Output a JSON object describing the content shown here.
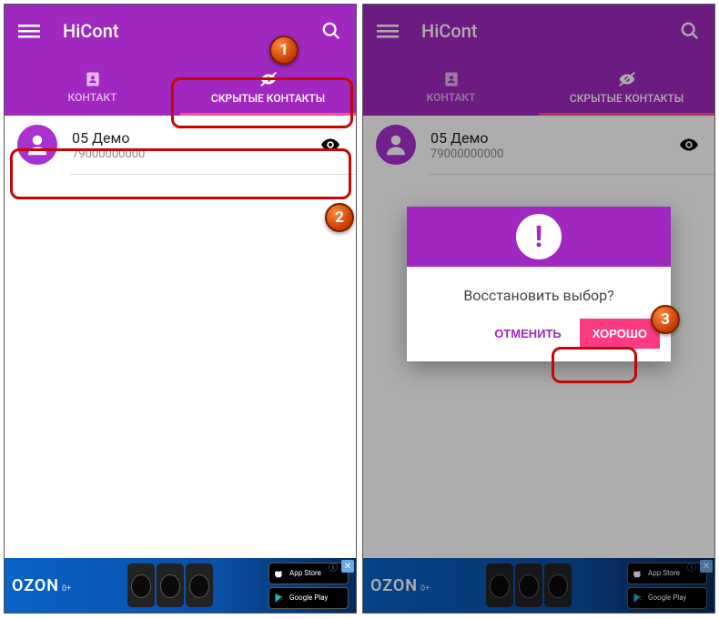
{
  "app": {
    "title": "HiCont"
  },
  "tabs": {
    "contact": "КОНТАКТ",
    "hidden": "СКРЫТЫЕ КОНТАКТЫ"
  },
  "contact": {
    "name": "05 Демо",
    "number": "79000000000"
  },
  "dialog": {
    "message": "Восстановить выбор?",
    "cancel": "ОТМЕНИТЬ",
    "ok": "ХОРОШО"
  },
  "ad": {
    "brand": "OZON",
    "age": "0+",
    "store1": "App Store",
    "store2": "Google Play"
  },
  "badges": {
    "b1": "1",
    "b2": "2",
    "b3": "3"
  }
}
